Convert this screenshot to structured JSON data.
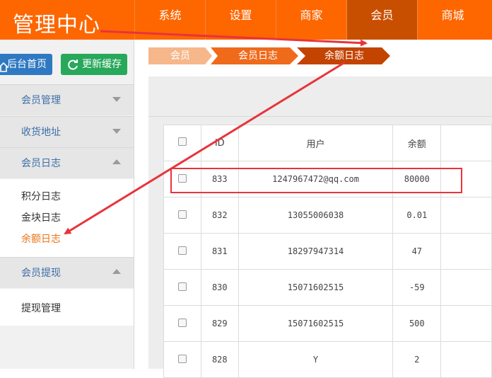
{
  "brand": {
    "title": "管理中心"
  },
  "nav": {
    "items": [
      "系统",
      "设置",
      "商家",
      "会员",
      "商城"
    ],
    "active": "会员"
  },
  "sidebar": {
    "home_button": "后台首页",
    "refresh_button": "更新缓存",
    "groups": [
      {
        "label": "会员管理",
        "expanded": false
      },
      {
        "label": "收货地址",
        "expanded": false
      },
      {
        "label": "会员日志",
        "expanded": true,
        "items": [
          "积分日志",
          "金块日志",
          "余额日志"
        ],
        "active_item": "余额日志"
      },
      {
        "label": "会员提现",
        "expanded": true,
        "items": [
          "提现管理"
        ]
      }
    ]
  },
  "breadcrumb": [
    "会员",
    "会员日志",
    "余额日志"
  ],
  "table": {
    "columns": [
      "",
      "ID",
      "用户",
      "余额"
    ],
    "rows": [
      {
        "id": "833",
        "user": "1247967472@qq.com",
        "balance": "80000"
      },
      {
        "id": "832",
        "user": "13055006038",
        "balance": "0.01"
      },
      {
        "id": "831",
        "user": "18297947314",
        "balance": "47"
      },
      {
        "id": "830",
        "user": "15071602515",
        "balance": "-59"
      },
      {
        "id": "829",
        "user": "15071602515",
        "balance": "500"
      },
      {
        "id": "828",
        "user": "Y",
        "balance": "2"
      }
    ]
  },
  "colors": {
    "brand_orange": "#fe6600",
    "nav_active": "#c94f00",
    "annotation_red": "#e8343b",
    "link_blue": "#3d6fa7",
    "active_item_orange": "#e8751a"
  }
}
